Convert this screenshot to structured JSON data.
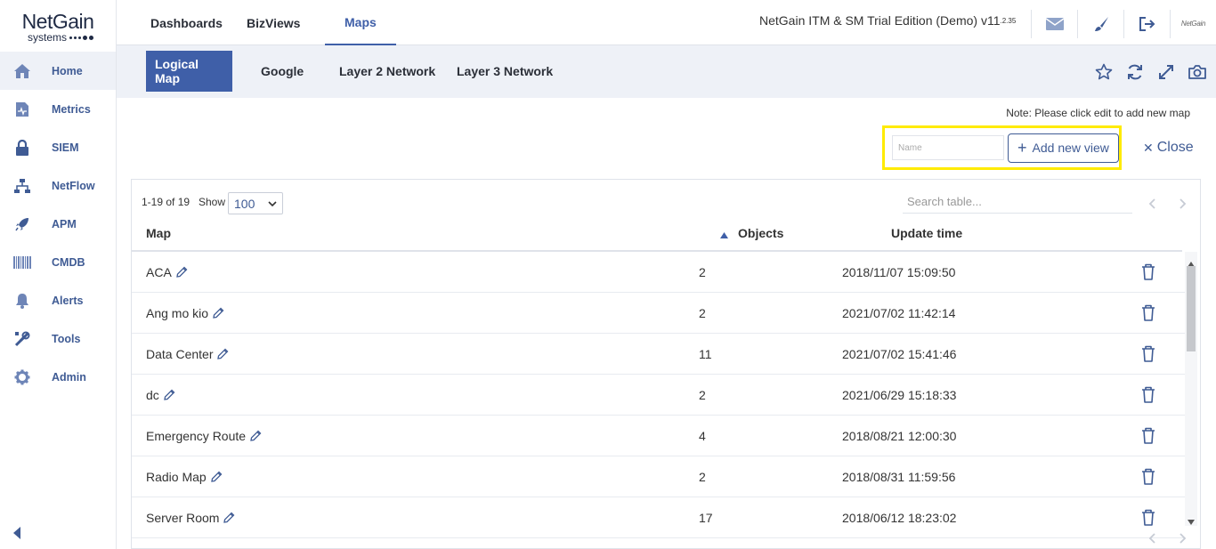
{
  "logo": {
    "main": "NetGain",
    "sub": "systems"
  },
  "sidebar": {
    "items": [
      {
        "label": "Home",
        "icon": "home-icon",
        "active": true
      },
      {
        "label": "Metrics",
        "icon": "metrics-icon"
      },
      {
        "label": "SIEM",
        "icon": "lock-icon"
      },
      {
        "label": "NetFlow",
        "icon": "network-icon"
      },
      {
        "label": "APM",
        "icon": "rocket-icon"
      },
      {
        "label": "CMDB",
        "icon": "barcode-icon"
      },
      {
        "label": "Alerts",
        "icon": "bell-icon"
      },
      {
        "label": "Tools",
        "icon": "tools-icon"
      },
      {
        "label": "Admin",
        "icon": "gear-icon"
      }
    ]
  },
  "header": {
    "tabs": [
      {
        "label": "Dashboards"
      },
      {
        "label": "BizViews"
      },
      {
        "label": "Maps",
        "active": true
      }
    ],
    "product": "NetGain ITM & SM Trial Edition (Demo) v11",
    "version_sup": ".2.35",
    "brand_mini": "NetGain"
  },
  "subnav": {
    "tabs": [
      {
        "label": "Logical Map",
        "active": true
      },
      {
        "label": "Google"
      },
      {
        "label": "Layer 2 Network"
      },
      {
        "label": "Layer 3 Network"
      }
    ]
  },
  "content": {
    "note": "Note: Please click edit to add new map",
    "name_placeholder": "Name",
    "add_button": "Add new view",
    "close_label": "Close"
  },
  "table": {
    "count_text": "1-19 of 19",
    "show_label": "Show",
    "show_value": "100",
    "search_placeholder": "Search table...",
    "columns": {
      "map": "Map",
      "objects": "Objects",
      "update_time": "Update time"
    },
    "rows": [
      {
        "map": "ACA",
        "objects": "2",
        "time": "2018/11/07 15:09:50"
      },
      {
        "map": "Ang mo kio",
        "objects": "2",
        "time": "2021/07/02 11:42:14"
      },
      {
        "map": "Data Center",
        "objects": "11",
        "time": "2021/07/02 15:41:46"
      },
      {
        "map": "dc",
        "objects": "2",
        "time": "2021/06/29 15:18:33"
      },
      {
        "map": "Emergency Route",
        "objects": "4",
        "time": "2018/08/21 12:00:30"
      },
      {
        "map": "Radio Map",
        "objects": "2",
        "time": "2018/08/31 11:59:56"
      },
      {
        "map": "Server Room",
        "objects": "17",
        "time": "2018/06/12 18:23:02"
      }
    ]
  },
  "colors": {
    "accent": "#3f5fa8",
    "nav_text": "#3f5b94",
    "highlight": "#ffeb00",
    "subbar_bg": "#eef1f7"
  }
}
